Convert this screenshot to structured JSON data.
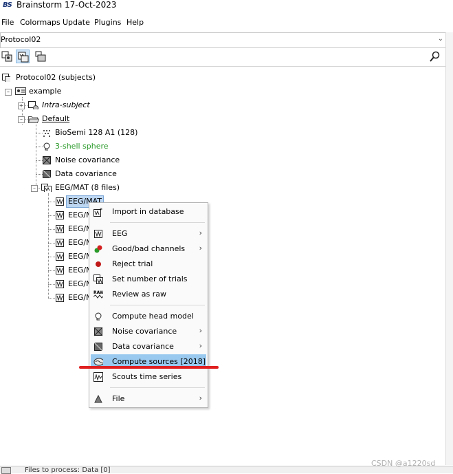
{
  "app": {
    "logo_text": "BS",
    "title": "Brainstorm 17-Oct-2023"
  },
  "menu": [
    "File",
    "Colormaps",
    "Update",
    "Plugins",
    "Help"
  ],
  "protocol_select": {
    "value": "Protocol02"
  },
  "toolbar": {
    "buttons": [
      "view-functional-data-icon",
      "view-subjects-icon",
      "view-studies-icon"
    ],
    "search_icon": "search-icon"
  },
  "tree": {
    "root": "Protocol02 (subjects)",
    "subject": "example",
    "intra": "Intra-subject",
    "default": "Default",
    "channel": "BioSemi 128 A1 (128)",
    "headmodel": "3-shell sphere",
    "noisecov": "Noise covariance",
    "datacov": "Data covariance",
    "eegfolder": "EEG/MAT (8 files)",
    "files": [
      "EEG/MAT",
      "EEG/M",
      "EEG/M",
      "EEG/M",
      "EEG/M",
      "EEG/M",
      "EEG/M",
      "EEG/M"
    ]
  },
  "context_menu": {
    "import": "Import in database",
    "eeg": "EEG",
    "goodbad": "Good/bad channels",
    "reject": "Reject trial",
    "setnum": "Set number of trials",
    "review": "Review as raw",
    "headmodel": "Compute head model",
    "noisecov": "Noise covariance",
    "datacov": "Data covariance",
    "sources": "Compute sources [2018]",
    "scouts": "Scouts time series",
    "file": "File",
    "submenu_arrow": "›"
  },
  "status": {
    "text": "Files to process: Data [0]"
  },
  "watermark": "CSDN @a1220sd",
  "colors": {
    "highlight": "#99c9ef",
    "annotation": "#e02020",
    "green_text": "#2a9a2a"
  }
}
